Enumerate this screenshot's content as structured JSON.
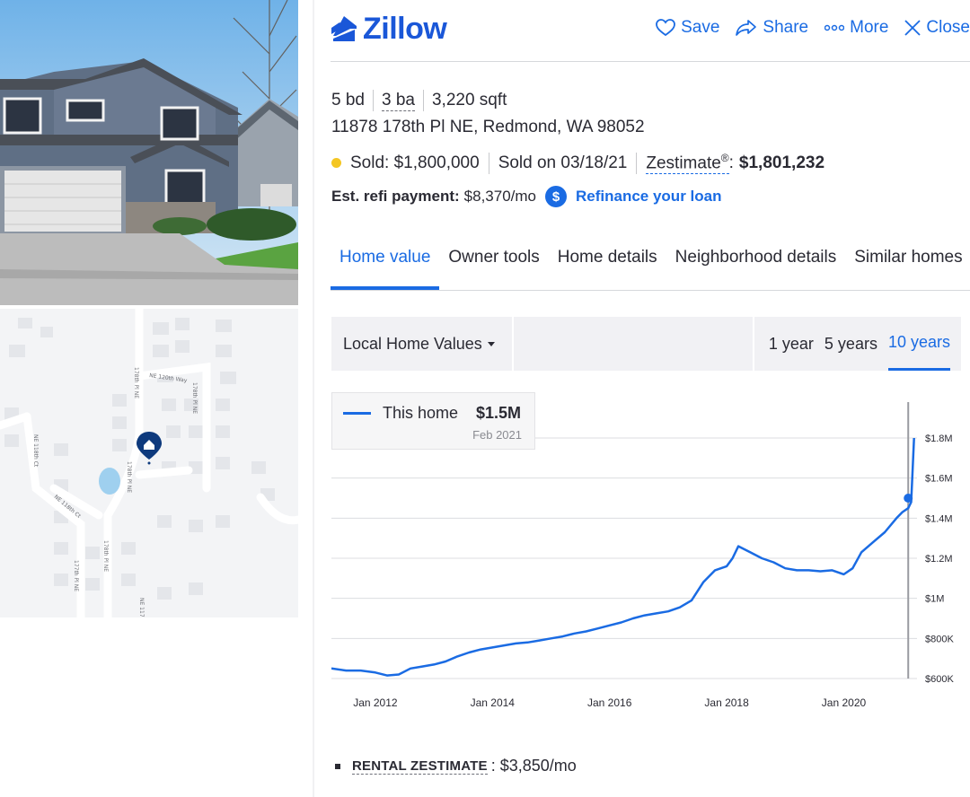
{
  "header": {
    "logo_text": "Zillow",
    "actions": [
      {
        "icon": "heart-icon",
        "label": "Save"
      },
      {
        "icon": "share-icon",
        "label": "Share"
      },
      {
        "icon": "more-icon",
        "label": "More"
      },
      {
        "icon": "close-icon",
        "label": "Close"
      }
    ]
  },
  "facts": {
    "beds": "5 bd",
    "baths": "3 ba",
    "sqft": "3,220 sqft",
    "address": "11878 178th Pl NE, Redmond, WA 98052",
    "sold_label": "Sold: $1,800,000",
    "sold_date": "Sold on 03/18/21",
    "zestimate_label": "Zestimate",
    "zestimate_reg": "®",
    "zestimate_colon": ":",
    "zestimate_value": "$1,801,232",
    "refi_label": "Est. refi payment:",
    "refi_value": "$8,370/mo",
    "refi_badge": "$",
    "refi_link": "Refinance your loan"
  },
  "tabs": [
    {
      "label": "Home value",
      "active": true
    },
    {
      "label": "Owner tools",
      "active": false
    },
    {
      "label": "Home details",
      "active": false
    },
    {
      "label": "Neighborhood details",
      "active": false
    },
    {
      "label": "Similar homes",
      "active": false
    }
  ],
  "chart_toolbar": {
    "dropdown_label": "Local Home Values",
    "ranges": [
      {
        "label": "1 year",
        "active": false
      },
      {
        "label": "5 years",
        "active": false
      },
      {
        "label": "10 years",
        "active": true
      }
    ]
  },
  "tooltip": {
    "series_name": "This home",
    "value": "$1.5M",
    "date": "Feb 2021"
  },
  "map": {
    "street_labels": [
      "NE 120th Way",
      "178th Pl NE",
      "178th Pl NE",
      "NE 118th Ct",
      "NE 118th Ct",
      "178th Pl NE",
      "177th Pl NE",
      "NE 117"
    ],
    "pin_icon": "home-pin-icon"
  },
  "rental": {
    "label": "RENTAL ZESTIMATE",
    "value": ": $3,850/mo"
  },
  "colors": {
    "brand": "#1a57d8",
    "accent": "#1a6be3",
    "sold_dot": "#f4c623"
  },
  "chart_data": {
    "type": "line",
    "title": "",
    "xlabel": "",
    "ylabel": "",
    "x_ticks": [
      "Jan 2012",
      "Jan 2014",
      "Jan 2016",
      "Jan 2018",
      "Jan 2020"
    ],
    "y_ticks": [
      "$600K",
      "$800K",
      "$1M",
      "$1.2M",
      "$1.4M",
      "$1.6M",
      "$1.8M"
    ],
    "ylim": [
      600000,
      1800000
    ],
    "xlim": [
      2011.25,
      2021.25
    ],
    "grid": true,
    "series": [
      {
        "name": "This home",
        "x": [
          2011.25,
          2011.5,
          2011.75,
          2012.0,
          2012.2,
          2012.4,
          2012.6,
          2012.8,
          2013.0,
          2013.2,
          2013.4,
          2013.6,
          2013.8,
          2014.0,
          2014.2,
          2014.4,
          2014.6,
          2014.8,
          2015.0,
          2015.2,
          2015.4,
          2015.6,
          2015.8,
          2016.0,
          2016.2,
          2016.4,
          2016.6,
          2016.8,
          2017.0,
          2017.2,
          2017.4,
          2017.6,
          2017.8,
          2018.0,
          2018.1,
          2018.2,
          2018.4,
          2018.6,
          2018.8,
          2019.0,
          2019.2,
          2019.4,
          2019.6,
          2019.8,
          2020.0,
          2020.15,
          2020.3,
          2020.5,
          2020.7,
          2020.9,
          2021.0,
          2021.1,
          2021.15,
          2021.2
        ],
        "values": [
          650000,
          640000,
          640000,
          630000,
          615000,
          620000,
          650000,
          660000,
          670000,
          685000,
          710000,
          730000,
          745000,
          755000,
          765000,
          775000,
          780000,
          790000,
          800000,
          810000,
          825000,
          835000,
          850000,
          865000,
          880000,
          900000,
          915000,
          925000,
          935000,
          955000,
          990000,
          1080000,
          1140000,
          1160000,
          1200000,
          1260000,
          1230000,
          1200000,
          1180000,
          1150000,
          1140000,
          1140000,
          1135000,
          1140000,
          1120000,
          1150000,
          1230000,
          1280000,
          1330000,
          1400000,
          1430000,
          1450000,
          1480000,
          1800000
        ]
      }
    ],
    "highlight": {
      "date": "Feb 2021",
      "value": 1500000
    }
  }
}
